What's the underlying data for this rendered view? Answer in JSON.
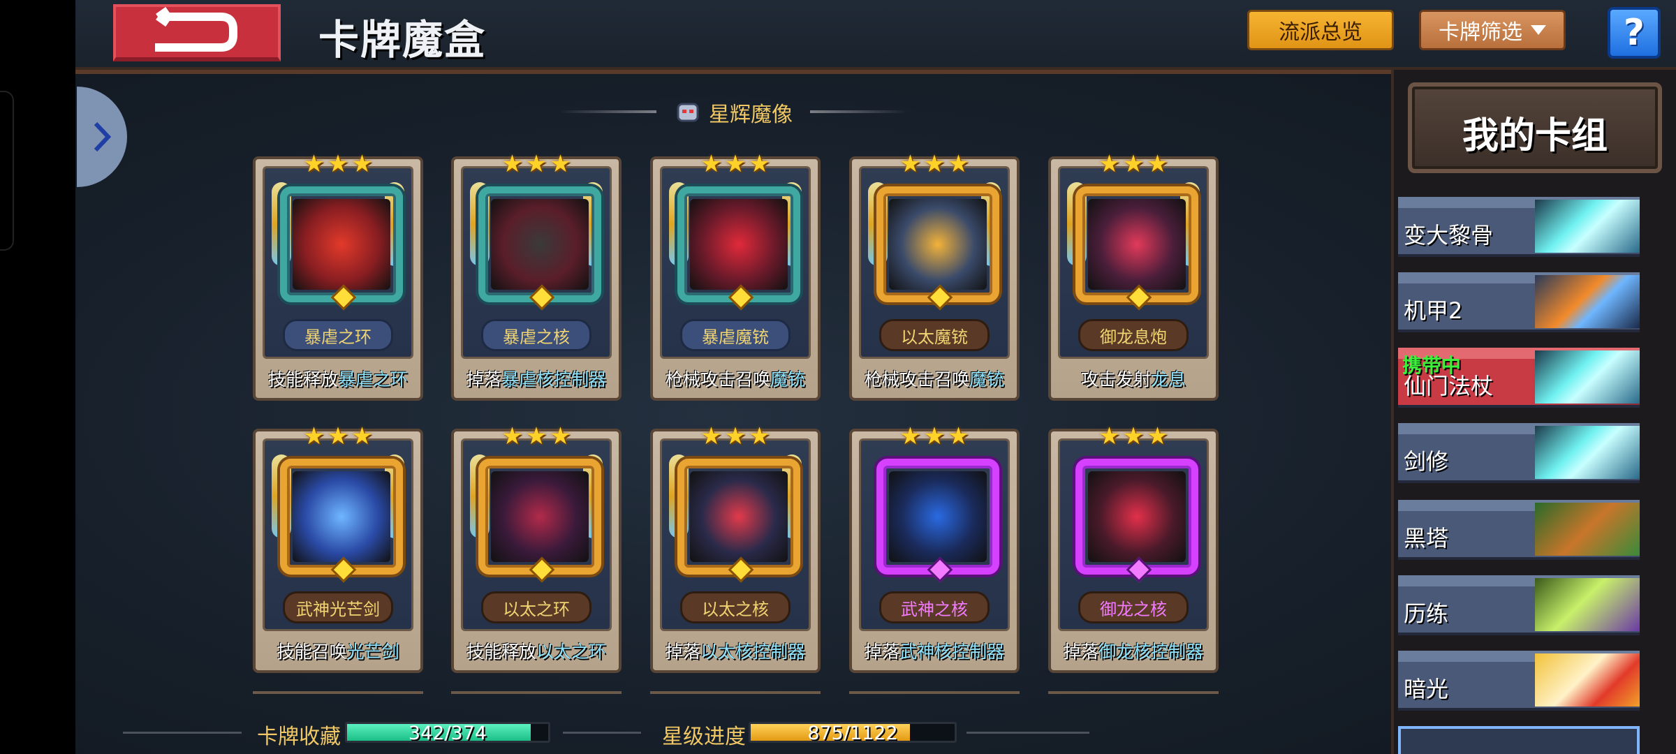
{
  "header": {
    "title": "卡牌魔盒",
    "faction_overview_label": "流派总览",
    "card_filter_label": "卡牌筛选",
    "help_label": "?"
  },
  "category": {
    "title": "星辉魔像"
  },
  "cards": [
    {
      "name": "暴虐之环",
      "desc_prefix": "技能释放",
      "desc_highlight": "暴虐之环",
      "desc_suffix": "",
      "stars": 3,
      "frame": "teal",
      "plate": "blue"
    },
    {
      "name": "暴虐之核",
      "desc_prefix": "掉落",
      "desc_highlight": "暴虐核控制器",
      "desc_suffix": "",
      "stars": 3,
      "frame": "teal",
      "plate": "blue"
    },
    {
      "name": "暴虐魔铳",
      "desc_prefix": "枪械攻击召唤",
      "desc_highlight": "魔铳",
      "desc_suffix": "",
      "stars": 3,
      "frame": "teal",
      "plate": "blue"
    },
    {
      "name": "以太魔铳",
      "desc_prefix": "枪械攻击召唤",
      "desc_highlight": "魔铳",
      "desc_suffix": "",
      "stars": 3,
      "frame": "gold",
      "plate": "brown"
    },
    {
      "name": "御龙息炮",
      "desc_prefix": "攻击发射",
      "desc_highlight": "龙息",
      "desc_suffix": "",
      "stars": 3,
      "frame": "gold",
      "plate": "brown"
    },
    {
      "name": "武神光芒剑",
      "desc_prefix": "技能召唤",
      "desc_highlight": "光芒剑",
      "desc_suffix": "",
      "stars": 3,
      "frame": "gold",
      "plate": "brown"
    },
    {
      "name": "以太之环",
      "desc_prefix": "技能释放",
      "desc_highlight": "以太之环",
      "desc_suffix": "",
      "stars": 3,
      "frame": "gold",
      "plate": "brown"
    },
    {
      "name": "以太之核",
      "desc_prefix": "掉落",
      "desc_highlight": "以太核控制器",
      "desc_suffix": "",
      "stars": 3,
      "frame": "gold",
      "plate": "brown"
    },
    {
      "name": "武神之核",
      "desc_prefix": "掉落",
      "desc_highlight": "武神核控制器",
      "desc_suffix": "",
      "stars": 3,
      "frame": "purple",
      "plate": "purple"
    },
    {
      "name": "御龙之核",
      "desc_prefix": "掉落",
      "desc_highlight": "御龙核控制器",
      "desc_suffix": "",
      "stars": 3,
      "frame": "purple",
      "plate": "purple"
    }
  ],
  "footer": {
    "collection_label": "卡牌收藏",
    "collection_value": "342/374",
    "collection_fraction": 0.914,
    "star_label": "星级进度",
    "star_value": "875/1122",
    "star_fraction": 0.78
  },
  "deck": {
    "title": "我的卡组",
    "items": [
      {
        "name": "变大黎骨",
        "badge": "",
        "icon": "sword-icon"
      },
      {
        "name": "机甲2",
        "badge": "",
        "icon": "mech-icon"
      },
      {
        "name": "仙门法杖",
        "badge": "携带中",
        "icon": "sword-icon"
      },
      {
        "name": "剑修",
        "badge": "",
        "icon": "sword-icon"
      },
      {
        "name": "黑塔",
        "badge": "",
        "icon": "tree-icon"
      },
      {
        "name": "历练",
        "badge": "",
        "icon": "skull-icon"
      },
      {
        "name": "暗光",
        "badge": "",
        "icon": "bird-icon"
      }
    ]
  },
  "colors": {
    "accent_gold": "#f1c864",
    "collection_bar": "#2ee3a6",
    "star_bar": "#f2b12a",
    "active_deck": "#c83a44",
    "highlight_text": "#8ee4ff"
  }
}
